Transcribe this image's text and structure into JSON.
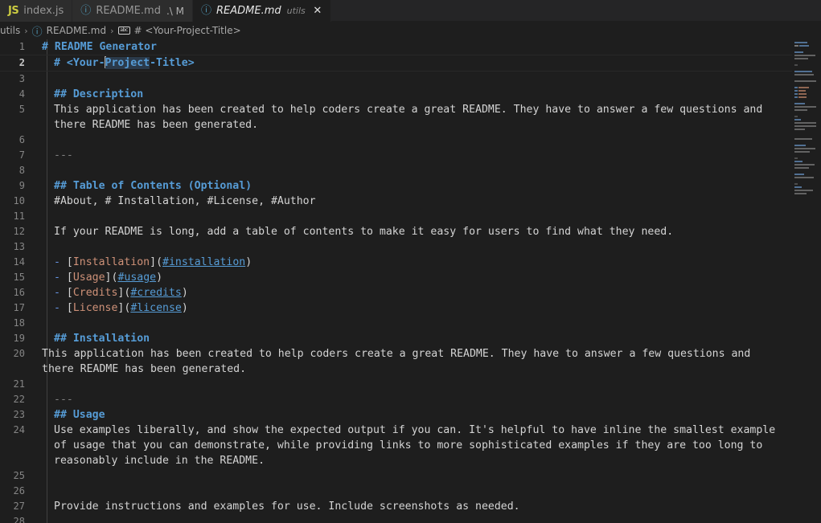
{
  "tabs": [
    {
      "icon": "js-icon",
      "icon_text": "JS",
      "label": "index.js",
      "desc": "",
      "dirty": "",
      "active": false,
      "closable": false
    },
    {
      "icon": "markdown-icon",
      "icon_text": "ⓘ",
      "label": "README.md",
      "desc": "",
      "dirty": ".\\ M",
      "active": false,
      "closable": false
    },
    {
      "icon": "markdown-icon",
      "icon_text": "ⓘ",
      "label": "README.md",
      "desc": "utils",
      "dirty": "",
      "active": true,
      "closable": true,
      "close_glyph": "✕"
    }
  ],
  "breadcrumb": {
    "items": [
      {
        "label": "utils",
        "icon": ""
      },
      {
        "label": "README.md",
        "icon": "markdown-icon"
      },
      {
        "label": "# <Your-Project-Title>",
        "icon": "abc-symbol-icon"
      }
    ],
    "separator": "›"
  },
  "editor": {
    "language": "markdown",
    "cursor_line": 2,
    "highlighted_word": "Project",
    "lines": [
      {
        "num": "1",
        "indent": false,
        "tokens": [
          {
            "c": "t-head",
            "t": "# README Generator"
          }
        ]
      },
      {
        "num": "2",
        "indent": true,
        "current": true,
        "tokens": [
          {
            "c": "t-head",
            "t": "# <Your-"
          },
          {
            "c": "cursor",
            "t": ""
          },
          {
            "c": "t-head sel-word",
            "t": "Project"
          },
          {
            "c": "t-head",
            "t": "-Title>"
          }
        ]
      },
      {
        "num": "3",
        "indent": true,
        "tokens": []
      },
      {
        "num": "4",
        "indent": true,
        "tokens": [
          {
            "c": "t-head",
            "t": "## Description"
          }
        ]
      },
      {
        "num": "5",
        "indent": true,
        "tokens": [
          {
            "c": "t-text",
            "t": "This application has been created to help coders create a great README. They have to answer a few questions and there README has been generated."
          }
        ]
      },
      {
        "num": "6",
        "indent": true,
        "tokens": []
      },
      {
        "num": "7",
        "indent": true,
        "tokens": [
          {
            "c": "t-hr",
            "t": "---"
          }
        ]
      },
      {
        "num": "8",
        "indent": true,
        "tokens": []
      },
      {
        "num": "9",
        "indent": true,
        "tokens": [
          {
            "c": "t-head",
            "t": "## Table of Contents (Optional)"
          }
        ]
      },
      {
        "num": "10",
        "indent": true,
        "tokens": [
          {
            "c": "t-text",
            "t": "#About, # Installation, #License, #Author"
          }
        ]
      },
      {
        "num": "11",
        "indent": true,
        "tokens": []
      },
      {
        "num": "12",
        "indent": true,
        "tokens": [
          {
            "c": "t-text",
            "t": "If your README is long, add a table of contents to make it easy for users to find what they need."
          }
        ]
      },
      {
        "num": "13",
        "indent": true,
        "tokens": []
      },
      {
        "num": "14",
        "indent": true,
        "tokens": [
          {
            "c": "t-bullet",
            "t": "- "
          },
          {
            "c": "t-brack",
            "t": "["
          },
          {
            "c": "t-linktext",
            "t": "Installation"
          },
          {
            "c": "t-brack",
            "t": "]("
          },
          {
            "c": "t-url",
            "t": "#installation"
          },
          {
            "c": "t-brack",
            "t": ")"
          }
        ]
      },
      {
        "num": "15",
        "indent": true,
        "tokens": [
          {
            "c": "t-bullet",
            "t": "- "
          },
          {
            "c": "t-brack",
            "t": "["
          },
          {
            "c": "t-linktext",
            "t": "Usage"
          },
          {
            "c": "t-brack",
            "t": "]("
          },
          {
            "c": "t-url",
            "t": "#usage"
          },
          {
            "c": "t-brack",
            "t": ")"
          }
        ]
      },
      {
        "num": "16",
        "indent": true,
        "tokens": [
          {
            "c": "t-bullet",
            "t": "- "
          },
          {
            "c": "t-brack",
            "t": "["
          },
          {
            "c": "t-linktext",
            "t": "Credits"
          },
          {
            "c": "t-brack",
            "t": "]("
          },
          {
            "c": "t-url",
            "t": "#credits"
          },
          {
            "c": "t-brack",
            "t": ")"
          }
        ]
      },
      {
        "num": "17",
        "indent": true,
        "tokens": [
          {
            "c": "t-bullet",
            "t": "- "
          },
          {
            "c": "t-brack",
            "t": "["
          },
          {
            "c": "t-linktext",
            "t": "License"
          },
          {
            "c": "t-brack",
            "t": "]("
          },
          {
            "c": "t-url",
            "t": "#license"
          },
          {
            "c": "t-brack",
            "t": ")"
          }
        ]
      },
      {
        "num": "18",
        "indent": true,
        "tokens": []
      },
      {
        "num": "19",
        "indent": true,
        "tokens": [
          {
            "c": "t-head",
            "t": "## Installation"
          }
        ]
      },
      {
        "num": "20",
        "indent": false,
        "tokens": [
          {
            "c": "t-text",
            "t": "This application has been created to help coders create a great README. They have to answer a few questions and there README has been generated."
          }
        ]
      },
      {
        "num": "21",
        "indent": true,
        "tokens": []
      },
      {
        "num": "22",
        "indent": true,
        "tokens": [
          {
            "c": "t-hr",
            "t": "---"
          }
        ]
      },
      {
        "num": "23",
        "indent": true,
        "tokens": [
          {
            "c": "t-head",
            "t": "## Usage"
          }
        ]
      },
      {
        "num": "24",
        "indent": true,
        "tokens": [
          {
            "c": "t-text",
            "t": "Use examples liberally, and show the expected output if you can. It's helpful to have inline the smallest example of usage that you can demonstrate, while providing links to more sophisticated examples if they are too long to reasonably include in the README."
          }
        ]
      },
      {
        "num": "25",
        "indent": true,
        "tokens": []
      },
      {
        "num": "26",
        "indent": true,
        "tokens": []
      },
      {
        "num": "27",
        "indent": true,
        "tokens": [
          {
            "c": "t-text",
            "t": "Provide instructions and examples for use. Include screenshots as needed."
          }
        ]
      },
      {
        "num": "28",
        "indent": true,
        "tokens": []
      }
    ]
  },
  "minimap": {
    "rows": [
      {
        "segs": [
          {
            "w": 16,
            "c": "#5a7fa8"
          }
        ]
      },
      {
        "segs": [
          {
            "w": 5,
            "c": "#8a8a8a"
          },
          {
            "w": 12,
            "c": "#5a7fa8"
          }
        ]
      },
      {
        "segs": []
      },
      {
        "segs": [
          {
            "w": 11,
            "c": "#5a7fa8"
          }
        ]
      },
      {
        "segs": [
          {
            "w": 26,
            "c": "#6e6e6e"
          }
        ]
      },
      {
        "segs": [
          {
            "w": 17,
            "c": "#6e6e6e"
          }
        ]
      },
      {
        "segs": []
      },
      {
        "segs": [
          {
            "w": 4,
            "c": "#555"
          }
        ]
      },
      {
        "segs": []
      },
      {
        "segs": [
          {
            "w": 22,
            "c": "#5a7fa8"
          }
        ]
      },
      {
        "segs": [
          {
            "w": 24,
            "c": "#6e6e6e"
          }
        ]
      },
      {
        "segs": []
      },
      {
        "segs": [
          {
            "w": 27,
            "c": "#6e6e6e"
          }
        ]
      },
      {
        "segs": []
      },
      {
        "segs": [
          {
            "w": 4,
            "c": "#5a7fa8"
          },
          {
            "w": 13,
            "c": "#a3735c"
          }
        ]
      },
      {
        "segs": [
          {
            "w": 4,
            "c": "#5a7fa8"
          },
          {
            "w": 9,
            "c": "#a3735c"
          }
        ]
      },
      {
        "segs": [
          {
            "w": 4,
            "c": "#5a7fa8"
          },
          {
            "w": 10,
            "c": "#a3735c"
          }
        ]
      },
      {
        "segs": [
          {
            "w": 4,
            "c": "#5a7fa8"
          },
          {
            "w": 10,
            "c": "#a3735c"
          }
        ]
      },
      {
        "segs": []
      },
      {
        "segs": [
          {
            "w": 13,
            "c": "#5a7fa8"
          }
        ]
      },
      {
        "segs": [
          {
            "w": 27,
            "c": "#6e6e6e"
          }
        ]
      },
      {
        "segs": [
          {
            "w": 16,
            "c": "#6e6e6e"
          }
        ]
      },
      {
        "segs": []
      },
      {
        "segs": [
          {
            "w": 4,
            "c": "#555"
          }
        ]
      },
      {
        "segs": [
          {
            "w": 8,
            "c": "#5a7fa8"
          }
        ]
      },
      {
        "segs": [
          {
            "w": 27,
            "c": "#6e6e6e"
          }
        ]
      },
      {
        "segs": [
          {
            "w": 27,
            "c": "#6e6e6e"
          }
        ]
      },
      {
        "segs": [
          {
            "w": 13,
            "c": "#6e6e6e"
          }
        ]
      },
      {
        "segs": []
      },
      {
        "segs": []
      },
      {
        "segs": [
          {
            "w": 22,
            "c": "#6e6e6e"
          }
        ]
      },
      {
        "segs": []
      },
      {
        "segs": [
          {
            "w": 14,
            "c": "#5a7fa8"
          }
        ]
      },
      {
        "segs": [
          {
            "w": 26,
            "c": "#6e6e6e"
          }
        ]
      },
      {
        "segs": [
          {
            "w": 19,
            "c": "#6e6e6e"
          }
        ]
      },
      {
        "segs": []
      },
      {
        "segs": [
          {
            "w": 4,
            "c": "#555"
          }
        ]
      },
      {
        "segs": [
          {
            "w": 10,
            "c": "#5a7fa8"
          }
        ]
      },
      {
        "segs": [
          {
            "w": 25,
            "c": "#6e6e6e"
          }
        ]
      },
      {
        "segs": [
          {
            "w": 18,
            "c": "#6e6e6e"
          }
        ]
      },
      {
        "segs": []
      },
      {
        "segs": [
          {
            "w": 12,
            "c": "#5a7fa8"
          }
        ]
      },
      {
        "segs": [
          {
            "w": 24,
            "c": "#6e6e6e"
          }
        ]
      },
      {
        "segs": []
      },
      {
        "segs": [
          {
            "w": 4,
            "c": "#555"
          }
        ]
      },
      {
        "segs": [
          {
            "w": 9,
            "c": "#5a7fa8"
          }
        ]
      },
      {
        "segs": [
          {
            "w": 23,
            "c": "#6e6e6e"
          }
        ]
      },
      {
        "segs": [
          {
            "w": 15,
            "c": "#6e6e6e"
          }
        ]
      },
      {
        "segs": []
      }
    ]
  },
  "colors": {
    "editor_bg": "#1e1e1e",
    "tabbar_bg": "#252526",
    "inactive_tab_bg": "#2d2d2d",
    "heading": "#569cd6",
    "link_text": "#ce9178",
    "link_url": "#569cd6",
    "body_text": "#d4d4d4",
    "line_number": "#858585",
    "active_line_number": "#c6c6c6"
  }
}
